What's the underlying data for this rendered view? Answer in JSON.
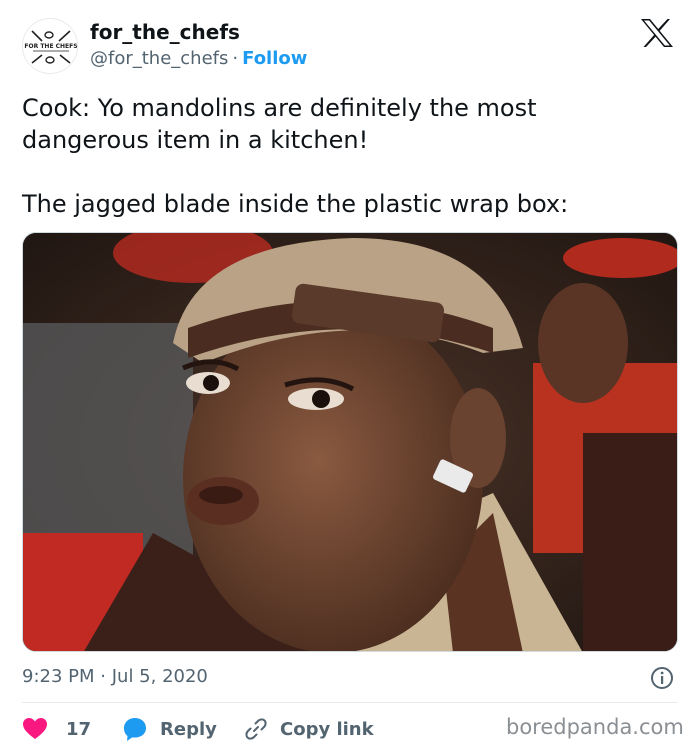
{
  "author": {
    "name": "for_the_chefs",
    "handle": "@for_the_chefs",
    "separator": "·",
    "follow_label": "Follow",
    "avatar_text": "FOR THE CHEFS",
    "avatar_icon": "whisk-and-spoon-logo"
  },
  "tweet": {
    "line1": "Cook: Yo mandolins are definitely the most",
    "line2": "dangerous item in a kitchen!",
    "line3": "The jagged blade inside the plastic wrap box:"
  },
  "media": {
    "kind": "photo",
    "icon": "photo-reaction-meme"
  },
  "meta": {
    "time": "9:23 PM",
    "separator": "·",
    "date": "Jul 5, 2020"
  },
  "actions": {
    "like_count": "17",
    "reply_label": "Reply",
    "copy_label": "Copy link"
  },
  "watermark": "boredpanda.com",
  "colors": {
    "accent": "#1d9bf0",
    "like": "#f91880",
    "text": "#0f1419",
    "muted": "#536471"
  }
}
